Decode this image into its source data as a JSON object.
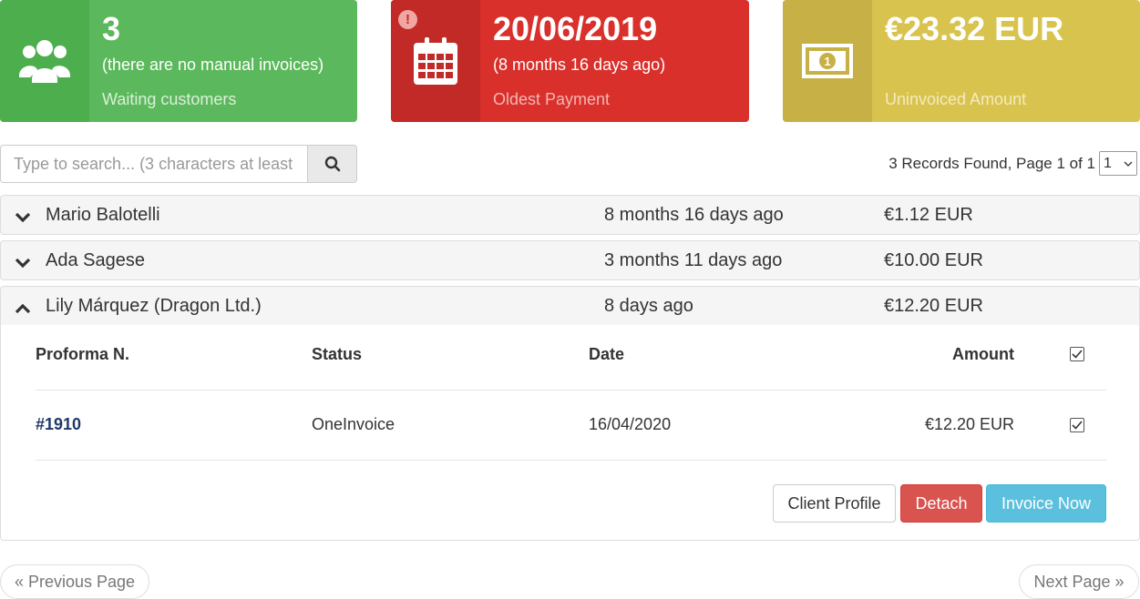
{
  "cards": {
    "waiting": {
      "value": "3",
      "sub": "(there are no manual invoices)",
      "caption": "Waiting customers",
      "icon": "users-icon"
    },
    "oldest": {
      "value": "20/06/2019",
      "sub": "(8 months 16 days ago)",
      "caption": "Oldest Payment",
      "icon": "calendar-icon",
      "alert": "!"
    },
    "uninvoiced": {
      "value": "€23.32 EUR",
      "sub": "",
      "caption": "Uninvoiced Amount",
      "icon": "money-icon"
    }
  },
  "search": {
    "placeholder": "Type to search... (3 characters at least"
  },
  "records": {
    "text": "3 Records Found, Page 1 of 1",
    "page": "1"
  },
  "customers": [
    {
      "name": "Mario Balotelli",
      "ago": "8 months 16 days ago",
      "amount": "€1.12 EUR",
      "expanded": false
    },
    {
      "name": "Ada Sagese",
      "ago": "3 months 11 days ago",
      "amount": "€10.00 EUR",
      "expanded": false
    },
    {
      "name": "Lily Márquez (Dragon Ltd.)",
      "ago": "8 days ago",
      "amount": "€12.20 EUR",
      "expanded": true
    }
  ],
  "detail": {
    "headers": {
      "proforma": "Proforma N.",
      "status": "Status",
      "date": "Date",
      "amount": "Amount"
    },
    "rows": [
      {
        "proforma": "#1910",
        "status": "OneInvoice",
        "date": "16/04/2020",
        "amount": "€12.20 EUR",
        "checked": true
      }
    ],
    "buttons": {
      "profile": "Client Profile",
      "detach": "Detach",
      "invoice": "Invoice Now"
    }
  },
  "pager": {
    "prev": "« Previous Page",
    "next": "Next Page »"
  },
  "colors": {
    "green": "#5cb85c",
    "red": "#d9302c",
    "yellow": "#d9c34f",
    "info": "#5bc0de",
    "danger": "#d9534f"
  }
}
